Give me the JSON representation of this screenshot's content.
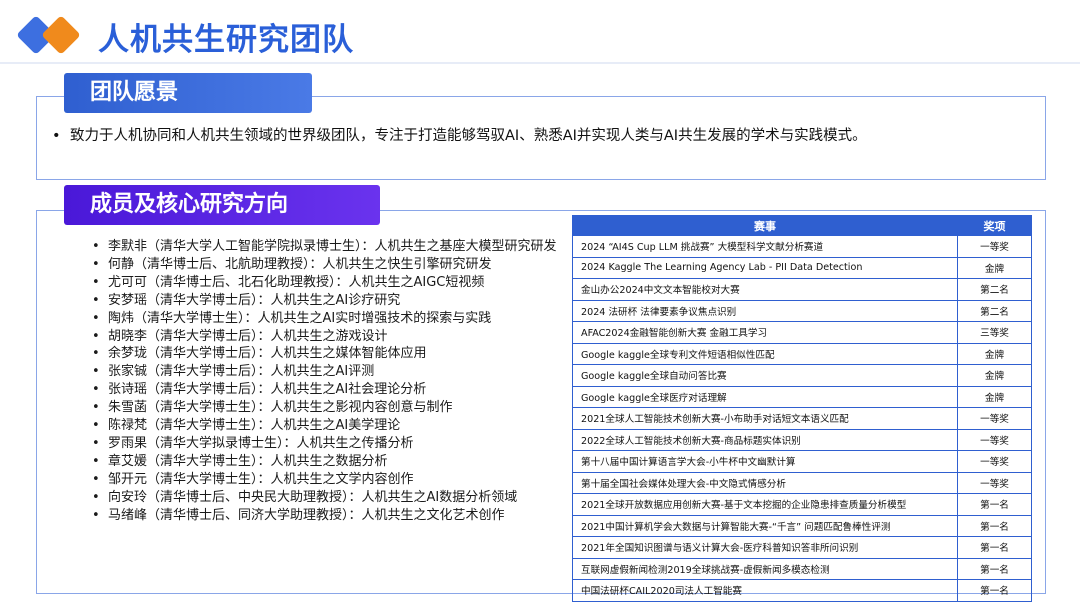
{
  "header": {
    "title": "人机共生研究团队"
  },
  "vision": {
    "title": "团队愿景",
    "text": "致力于人机协同和人机共生领域的世界级团队，专注于打造能够驾驭AI、熟悉AI并实现人类与AI共生发展的学术与实践模式。"
  },
  "members": {
    "title": "成员及核心研究方向",
    "items": [
      "李默非（清华大学人工智能学院拟录博士生）：人机共生之基座大模型研究研发",
      "何静（清华博士后、北航助理教授）：人机共生之快生引擎研究研发",
      "尤可可（清华博士后、北石化助理教授）：人机共生之AIGC短视频",
      "安梦瑶（清华大学博士后）：人机共生之AI诊疗研究",
      "陶炜（清华大学博士生）：人机共生之AI实时增强技术的探索与实践",
      "胡晓李（清华大学博士后）：人机共生之游戏设计",
      "余梦珑（清华大学博士后）：人机共生之媒体智能体应用",
      "张家铖（清华大学博士后）：人机共生之AI评测",
      "张诗瑶（清华大学博士后）：人机共生之AI社会理论分析",
      "朱雪菡（清华大学博士生）：人机共生之影视内容创意与制作",
      "陈禄梵（清华大学博士生）：人机共生之AI美学理论",
      "罗雨果（清华大学拟录博士生）：人机共生之传播分析",
      "章艾媛（清华大学博士生）：人机共生之数据分析",
      "邹开元（清华大学博士生）：人机共生之文学内容创作",
      "向安玲（清华博士后、中央民大助理教授）：人机共生之AI数据分析领域",
      "马绪峰（清华博士后、同济大学助理教授）：人机共生之文化艺术创作"
    ]
  },
  "awards": {
    "headers": [
      "赛事",
      "奖项"
    ],
    "rows": [
      [
        "2024 “AI4S Cup LLM 挑战赛” 大模型科学文献分析赛道",
        "一等奖"
      ],
      [
        "2024 Kaggle The Learning Agency Lab - PII Data Detection",
        "金牌"
      ],
      [
        "金山办公2024中文文本智能校对大赛",
        "第二名"
      ],
      [
        "2024 法研杯 法律要素争议焦点识别",
        "第二名"
      ],
      [
        "AFAC2024金融智能创新大赛 金融工具学习",
        "三等奖"
      ],
      [
        "Google kaggle全球专利文件短语相似性匹配",
        "金牌"
      ],
      [
        "Google kaggle全球自动问答比赛",
        "金牌"
      ],
      [
        "Google kaggle全球医疗对话理解",
        "金牌"
      ],
      [
        "2021全球人工智能技术创新大赛-小布助手对话短文本语义匹配",
        "一等奖"
      ],
      [
        "2022全球人工智能技术创新大赛-商品标题实体识别",
        "一等奖"
      ],
      [
        "第十八届中国计算语言学大会-小牛杯中文幽默计算",
        "一等奖"
      ],
      [
        "第十届全国社会媒体处理大会-中文隐式情感分析",
        "一等奖"
      ],
      [
        "2021全球开放数据应用创新大赛-基于文本挖掘的企业隐患排查质量分析模型",
        "第一名"
      ],
      [
        "2021中国计算机学会大数据与计算智能大赛-“千言” 问题匹配鲁棒性评测",
        "第一名"
      ],
      [
        "2021年全国知识图谱与语义计算大会-医疗科普知识答非所问识别",
        "第一名"
      ],
      [
        "互联网虚假新闻检测2019全球挑战赛-虚假新闻多模态检测",
        "第一名"
      ],
      [
        "中国法研杯CAIL2020司法人工智能赛",
        "第一名"
      ]
    ]
  }
}
